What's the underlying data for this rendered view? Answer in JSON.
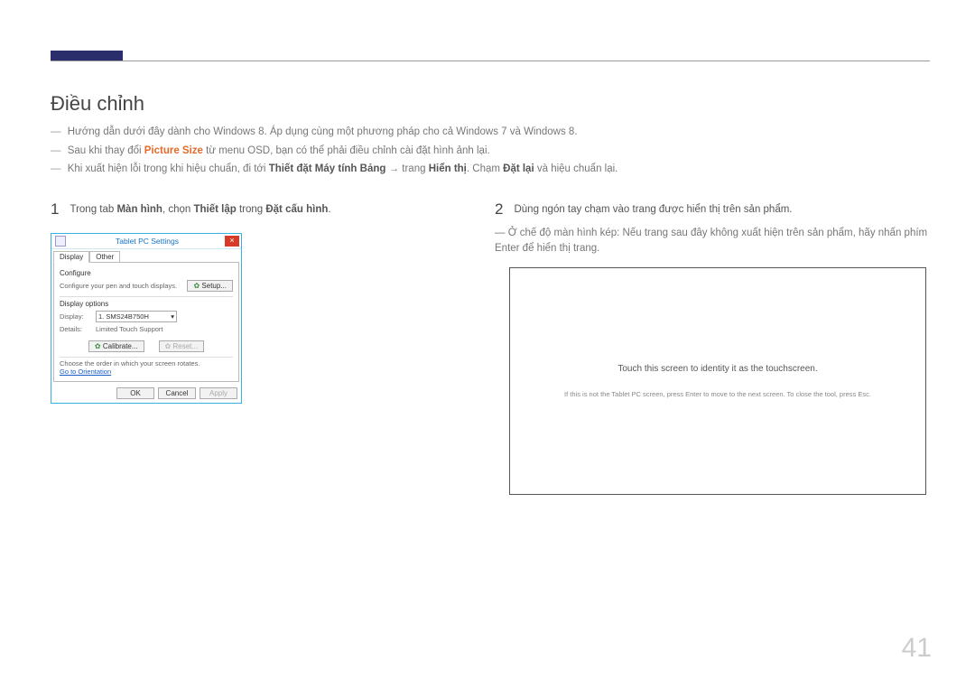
{
  "header": {
    "title": "Điều chỉnh"
  },
  "notes": {
    "line1": "Hướng dẫn dưới đây dành cho Windows 8. Áp dụng cùng một phương pháp cho cả Windows 7 và Windows 8.",
    "line2_a": "Sau khi thay đổi ",
    "line2_b": "Picture Size",
    "line2_c": " từ menu OSD, bạn có thể phải điều chỉnh cài đặt hình ảnh lại.",
    "line3_a": "Khi xuất hiện lỗi trong khi hiệu chuẩn, đi tới ",
    "line3_b": "Thiết đặt Máy tính Bảng",
    "line3_c": " → trang ",
    "line3_d": "Hiển thị",
    "line3_e": ". Chạm ",
    "line3_f": "Đặt lại",
    "line3_g": " và hiệu chuẩn lại."
  },
  "step1": {
    "num": "1",
    "text_a": "Trong tab ",
    "text_b": "Màn hình",
    "text_c": ", chọn ",
    "text_d": "Thiết lập",
    "text_e": " trong ",
    "text_f": "Đặt cấu hình",
    "text_g": "."
  },
  "dialog": {
    "title": "Tablet PC Settings",
    "close": "×",
    "tabs": {
      "display": "Display",
      "other": "Other"
    },
    "configure_lbl": "Configure",
    "configure_desc": "Configure your pen and touch displays.",
    "setup_btn": "Setup...",
    "display_options_lbl": "Display options",
    "display_lbl": "Display:",
    "display_value": "1. SMS24B750H",
    "details_lbl": "Details:",
    "details_value": "Limited Touch Support",
    "calibrate_btn": "Calibrate...",
    "reset_btn": "Reset...",
    "orientation_msg": "Choose the order in which your screen rotates.",
    "orientation_link": "Go to Orientation",
    "ok": "OK",
    "cancel": "Cancel",
    "apply": "Apply"
  },
  "step2": {
    "num": "2",
    "text": "Dùng ngón tay chạm vào trang được hiển thị trên sản phẩm.",
    "subnote": "Ở chế độ màn hình kép: Nếu trang sau đây không xuất hiện trên sản phẩm, hãy nhấn phím Enter để hiển thị trang."
  },
  "touchbox": {
    "msg1": "Touch this screen to identity it as the touchscreen.",
    "msg2": "If this is not the Tablet PC screen, press Enter to move to the next screen. To close the tool, press Esc."
  },
  "page_number": "41"
}
